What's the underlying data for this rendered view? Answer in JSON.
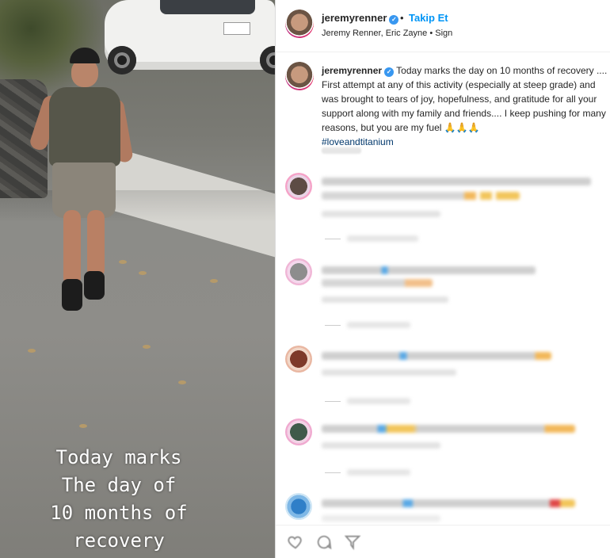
{
  "media": {
    "overlay_lines": [
      "Today marks",
      "The day of",
      "10 months of",
      "recovery"
    ]
  },
  "header": {
    "username": "jeremyrenner",
    "separator": "•",
    "follow_label": "Takip Et",
    "subline": "Jeremy Renner, Eric Zayne • Sign"
  },
  "caption": {
    "username": "jeremyrenner",
    "text": "Today marks the day on 10 months of recovery .... First attempt at any of this activity (especially at steep grade) and was brought to tears of joy, hopefulness, and gratitude for all your support along with my family and friends.... I keep pushing for many reasons, but you are my fuel 🙏🙏🙏",
    "hashtag": "#loveandtitanium"
  },
  "icons": {
    "verified": "verified-badge-icon",
    "like": "heart-icon",
    "comment": "comment-icon",
    "share": "share-icon"
  },
  "colors": {
    "accent": "#0095f6",
    "verified": "#3897f0",
    "hashtag": "#00376b"
  }
}
